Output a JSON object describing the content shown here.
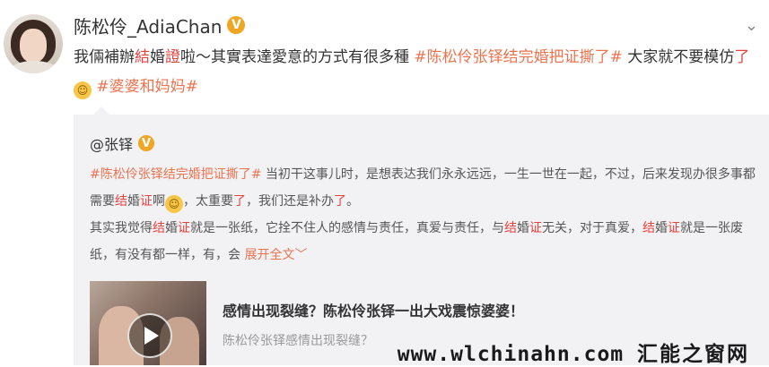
{
  "post": {
    "author_name": "陈松伶_AdiaChan",
    "verified_badge": "V",
    "menu_icon": "chevron-down-icon",
    "text_segments": [
      {
        "t": "我倆補辦",
        "style": "plain"
      },
      {
        "t": "結",
        "style": "kw"
      },
      {
        "t": "婚",
        "style": "plain"
      },
      {
        "t": "證",
        "style": "kw"
      },
      {
        "t": "啦～其實表達愛意的方式有很多種 ",
        "style": "plain"
      },
      {
        "t": "#陈松伶张铎结完婚把证撕了#",
        "style": "tag"
      },
      {
        "t": " 大家就不要模仿",
        "style": "plain"
      },
      {
        "t": "了",
        "style": "kw"
      }
    ],
    "emoji_1": "laugh-emoji",
    "hashtag_2": "#婆婆和妈妈#"
  },
  "repost": {
    "author": "@张铎",
    "verified_badge": "V",
    "segments": [
      {
        "t": "#陈松伶张铎结完婚把证撕了#",
        "style": "tag"
      },
      {
        "t": " 当初干这事儿时，是想表达我们永永远远，一生一世在一起，不过，后来发现办很多事都需要",
        "style": "plain"
      },
      {
        "t": "结",
        "style": "kw"
      },
      {
        "t": "婚",
        "style": "plain"
      },
      {
        "t": "证",
        "style": "kw"
      },
      {
        "t": "啊",
        "style": "plain"
      },
      {
        "t": "[emoji]",
        "style": "emoji"
      },
      {
        "t": "，太重要",
        "style": "plain"
      },
      {
        "t": "了",
        "style": "kw"
      },
      {
        "t": "，我们还是补办",
        "style": "plain"
      },
      {
        "t": "了",
        "style": "kw"
      },
      {
        "t": "。",
        "style": "plain"
      },
      {
        "t": "\n",
        "style": "br"
      },
      {
        "t": "其实我觉得",
        "style": "plain"
      },
      {
        "t": "结",
        "style": "kw"
      },
      {
        "t": "婚",
        "style": "plain"
      },
      {
        "t": "证",
        "style": "kw"
      },
      {
        "t": "就是一张纸，它拴不住人的感情与责任，真爱与责任，与",
        "style": "plain"
      },
      {
        "t": "结",
        "style": "kw"
      },
      {
        "t": "婚",
        "style": "plain"
      },
      {
        "t": "证",
        "style": "kw"
      },
      {
        "t": "无关，对于真爱，",
        "style": "plain"
      },
      {
        "t": "结",
        "style": "kw"
      },
      {
        "t": "婚",
        "style": "plain"
      },
      {
        "t": "证",
        "style": "kw"
      },
      {
        "t": "就是一张废纸，有没有都一样，有，会 ",
        "style": "plain"
      }
    ],
    "expand_label": "展开全文﹀",
    "card": {
      "title": "感情出现裂缝？陈松伶张铎一出大戏震惊婆婆！",
      "subtitle": "陈松伶张铎感情出现裂缝？",
      "play_icon": "play-icon"
    }
  },
  "watermark": {
    "url": "www.wlchinahn.com",
    "cn": "汇能之窗网"
  },
  "colors": {
    "keyword_red": "#e8413d",
    "hashtag_orange": "#eb7350",
    "verified": "#f0a523",
    "repost_bg": "#f2f2f5"
  }
}
